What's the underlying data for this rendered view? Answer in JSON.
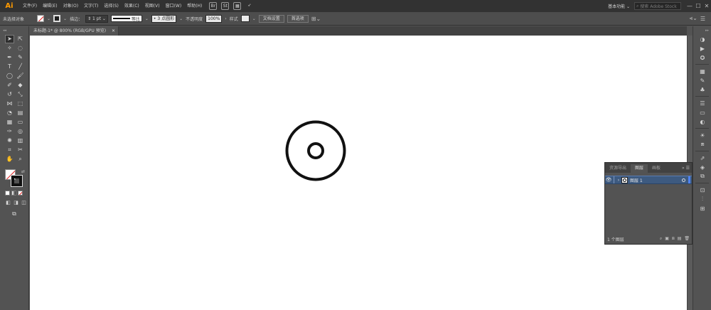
{
  "app": {
    "logo": "Ai"
  },
  "menu": {
    "items": [
      "文件(F)",
      "编辑(E)",
      "对象(O)",
      "文字(T)",
      "选择(S)",
      "效果(C)",
      "视图(V)",
      "窗口(W)",
      "帮助(H)"
    ],
    "br_icon": "Br",
    "st_icon": "St",
    "workspace": "基本功能 ⌄",
    "stock_search_placeholder": "搜索 Adobe Stock",
    "window_min": "—",
    "window_max": "☐",
    "window_close": "✕"
  },
  "control": {
    "selection_label": "未选择对象",
    "stroke_label": "描边：",
    "stroke_weight": "1 pt",
    "stroke_profile": "等比",
    "brush": "3 点圆形",
    "opacity_label": "不透明度",
    "opacity_value": "100%",
    "style_label": "样式",
    "doc_setup_button": "文档设置",
    "preferences_button": "首选项"
  },
  "document": {
    "tab_title": "未标题-1* @ 800% (RGB/GPU 预览)",
    "tab_close": "✕"
  },
  "layers_panel": {
    "tabs": [
      "资源导出",
      "图层",
      "画板"
    ],
    "active_tab": 1,
    "layer_name": "图层 1",
    "layer_count": "1 个图层"
  },
  "colors": {
    "ui_dark": "#323232",
    "ui_panel": "#535353",
    "selection": "#3d5a80",
    "layer_color": "#4f83f0",
    "logo": "#ff9a00"
  },
  "icons": {
    "tools": [
      "selection-tool-icon",
      "direct-selection-tool-icon",
      "magic-wand-icon",
      "lasso-icon",
      "pen-tool-icon",
      "curvature-tool-icon",
      "type-tool-icon",
      "line-tool-icon",
      "ellipse-tool-icon",
      "paintbrush-icon",
      "shaper-tool-icon",
      "eraser-icon",
      "rotate-tool-icon",
      "scale-tool-icon",
      "width-tool-icon",
      "free-transform-icon",
      "shape-builder-icon",
      "perspective-grid-icon",
      "mesh-tool-icon",
      "gradient-tool-icon",
      "eyedropper-icon",
      "blend-tool-icon",
      "symbol-sprayer-icon",
      "column-graph-icon",
      "artboard-tool-icon",
      "slice-tool-icon",
      "hand-tool-icon",
      "zoom-tool-icon"
    ]
  }
}
